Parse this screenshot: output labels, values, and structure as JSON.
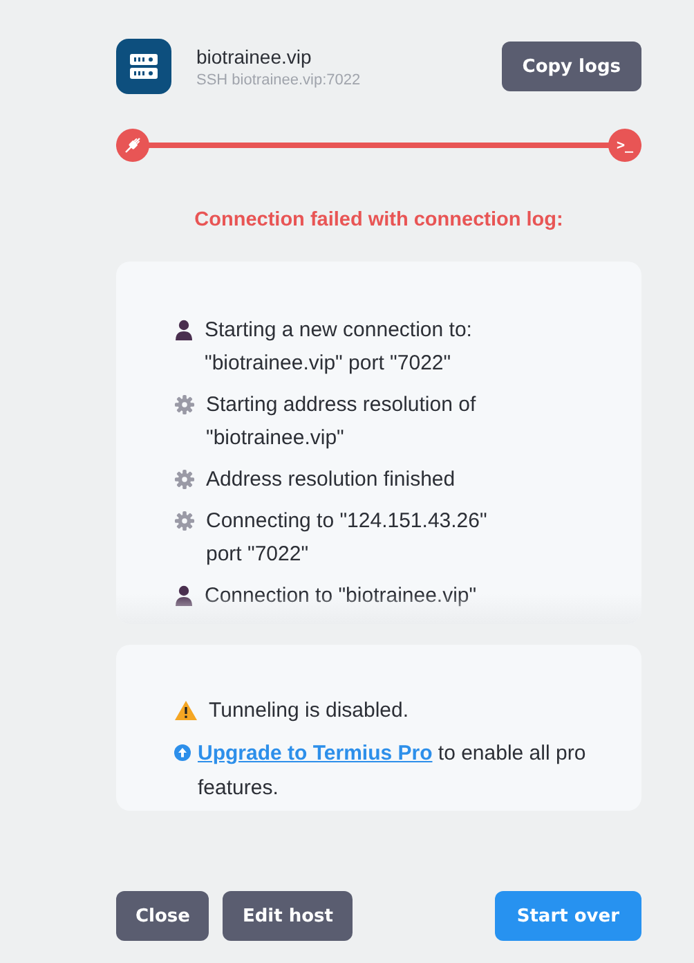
{
  "host": {
    "name": "biotrainee.vip",
    "address": "SSH biotrainee.vip:7022"
  },
  "copy_button": "Copy logs",
  "progress": {
    "end_label": ">_"
  },
  "error_title": "Connection failed with connection log:",
  "log": [
    {
      "kind": "user",
      "text": "Starting a new connection to: \"biotrainee.vip\" port \"7022\""
    },
    {
      "kind": "system",
      "text": "Starting address resolution of \"biotrainee.vip\""
    },
    {
      "kind": "system",
      "text": "Address resolution finished"
    },
    {
      "kind": "system",
      "text": "Connecting to \"124.151.43.26\" port \"7022\""
    },
    {
      "kind": "user",
      "text": "Connection to \"biotrainee.vip\""
    }
  ],
  "notice": {
    "warning": "Tunneling is disabled.",
    "link": "Upgrade to Termius Pro",
    "rest": "to enable all pro features."
  },
  "buttons": [
    {
      "label": "Close",
      "kind": "secondary"
    },
    {
      "label": "Edit host",
      "kind": "secondary"
    },
    {
      "label": "Start over",
      "kind": "primary"
    }
  ]
}
